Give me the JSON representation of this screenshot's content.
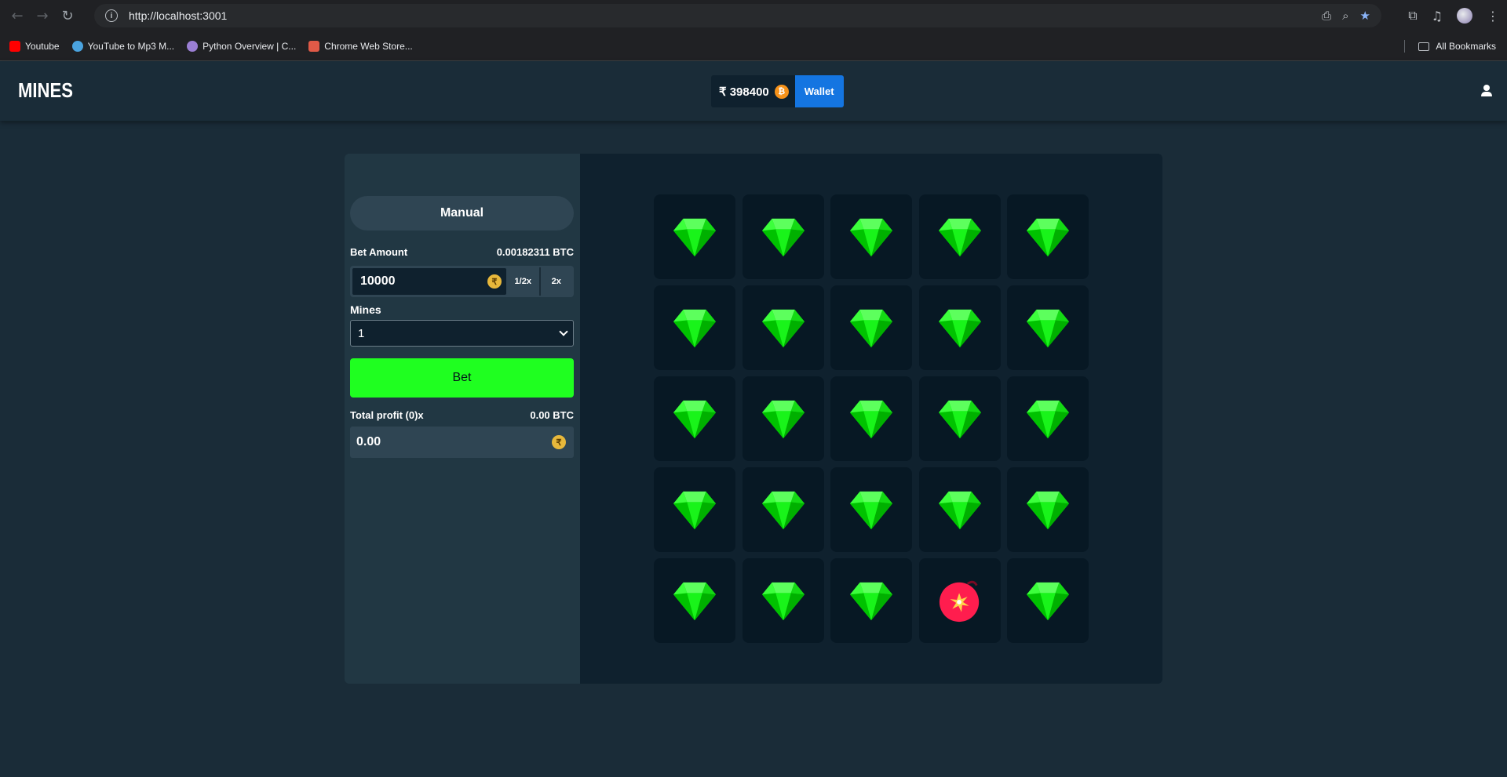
{
  "browser": {
    "url": "http://localhost:3001",
    "bookmarks": [
      {
        "label": "Youtube",
        "color": "#ff0000"
      },
      {
        "label": "YouTube to Mp3 M...",
        "color": "#4aa3df"
      },
      {
        "label": "Python Overview | C...",
        "color": "#9b7fd4"
      },
      {
        "label": "Chrome Web Store...",
        "color": "#e05a47"
      }
    ],
    "all_bookmarks": "All Bookmarks"
  },
  "header": {
    "logo": "MINES",
    "balance": "₹ 398400",
    "coin_symbol": "₿",
    "wallet_label": "Wallet"
  },
  "sidebar": {
    "tab_label": "Manual",
    "bet_amount_label": "Bet Amount",
    "bet_amount_btc": "0.00182311 BTC",
    "bet_value": "10000",
    "currency_symbol": "₹",
    "half_label": "1/2x",
    "double_label": "2x",
    "mines_label": "Mines",
    "mines_value": "1",
    "bet_button": "Bet",
    "profit_label": "Total profit (0)x",
    "profit_btc": "0.00 BTC",
    "profit_value": "0.00"
  },
  "board": {
    "rows": 5,
    "cols": 5,
    "tiles": [
      "gem",
      "gem",
      "gem",
      "gem",
      "gem",
      "gem",
      "gem",
      "gem",
      "gem",
      "gem",
      "gem",
      "gem",
      "gem",
      "gem",
      "gem",
      "gem",
      "gem",
      "gem",
      "gem",
      "gem",
      "gem",
      "gem",
      "gem",
      "mine",
      "gem"
    ],
    "gem_color": "#00e701",
    "mine_color": "#ff1d4e"
  }
}
